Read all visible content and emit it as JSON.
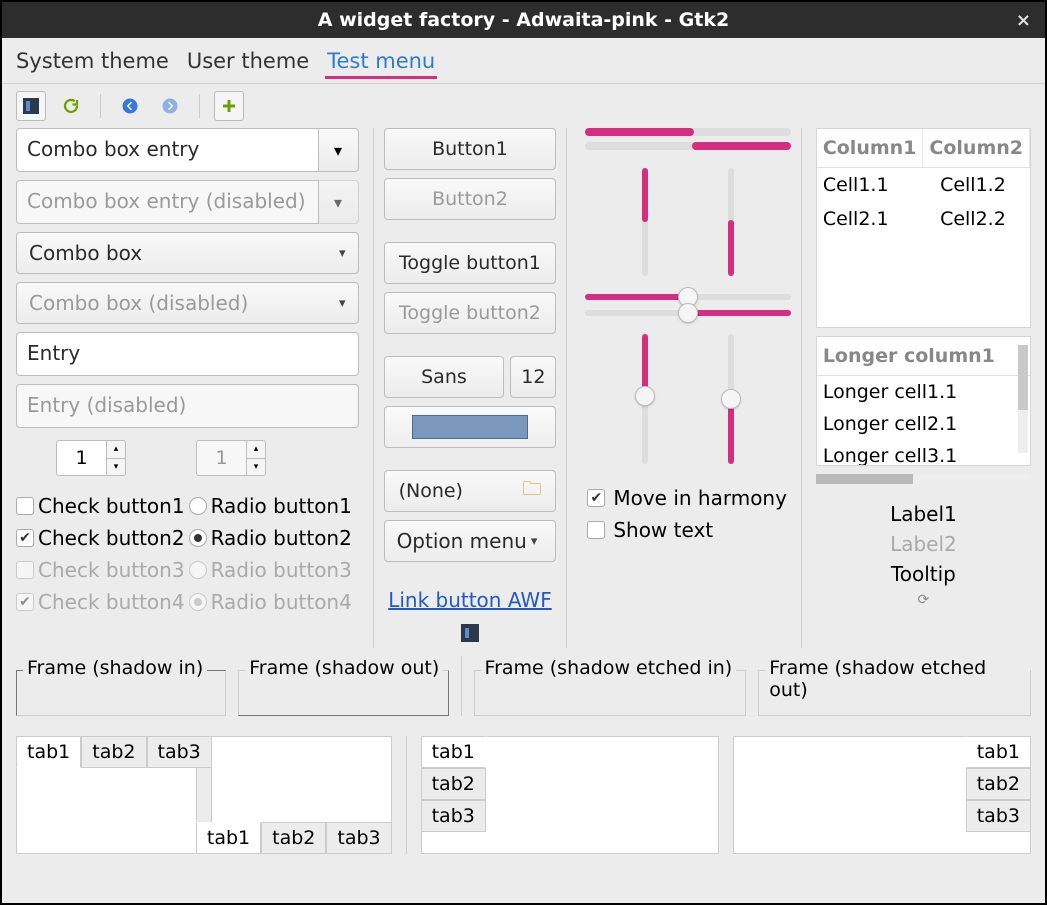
{
  "window": {
    "title": "A widget factory - Adwaita-pink - Gtk2"
  },
  "menubar": {
    "items": [
      "System theme",
      "User theme",
      "Test menu"
    ],
    "active_index": 2
  },
  "col1": {
    "combo_entry": "Combo box entry",
    "combo_entry_disabled": "Combo box entry (disabled)",
    "combo": "Combo box",
    "combo_disabled": "Combo box (disabled)",
    "entry": "Entry",
    "entry_disabled": "Entry (disabled)",
    "spin1": "1",
    "spin2": "1",
    "checks": [
      "Check button1",
      "Check button2",
      "Check button3",
      "Check button4"
    ],
    "radios": [
      "Radio button1",
      "Radio button2",
      "Radio button3",
      "Radio button4"
    ]
  },
  "col2": {
    "button1": "Button1",
    "button2": "Button2",
    "toggle1": "Toggle button1",
    "toggle2": "Toggle button2",
    "font_name": "Sans",
    "font_size": "12",
    "file": "(None)",
    "option": "Option menu",
    "link": "Link button AWF"
  },
  "col3": {
    "harmony": "Move in harmony",
    "showtext": "Show text"
  },
  "col4": {
    "table1": {
      "headers": [
        "Column1",
        "Column2"
      ],
      "rows": [
        [
          "Cell1.1",
          "Cell1.2"
        ],
        [
          "Cell2.1",
          "Cell2.2"
        ]
      ]
    },
    "table2": {
      "header": "Longer column1",
      "rows": [
        "Longer cell1.1",
        "Longer cell2.1",
        "Longer cell3.1"
      ]
    },
    "label1": "Label1",
    "label2": "Label2",
    "tooltip": "Tooltip"
  },
  "frames": [
    "Frame (shadow in)",
    "Frame (shadow out)",
    "Frame (shadow etched in)",
    "Frame (shadow etched out)"
  ],
  "tabs": [
    "tab1",
    "tab2",
    "tab3"
  ]
}
